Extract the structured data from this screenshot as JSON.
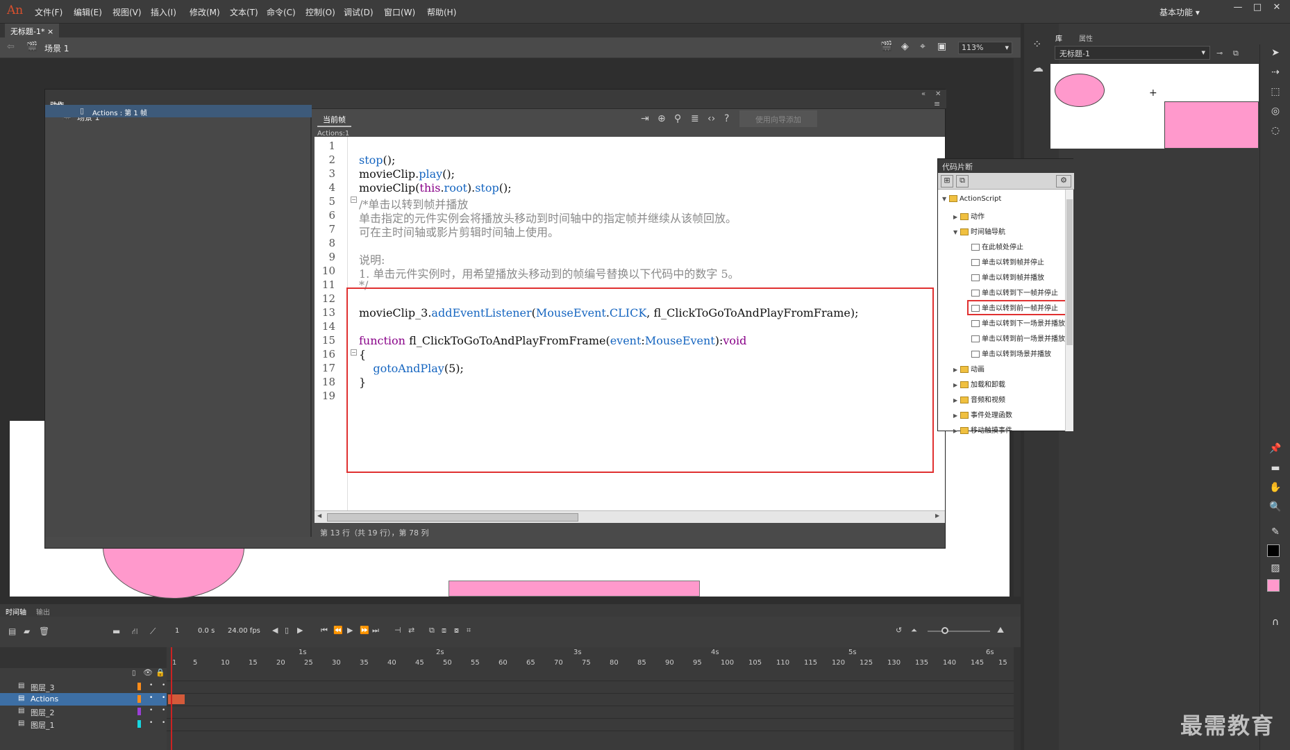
{
  "app": {
    "logo": "An"
  },
  "menu": [
    "文件(F)",
    "编辑(E)",
    "视图(V)",
    "插入(I)",
    "修改(M)",
    "文本(T)",
    "命令(C)",
    "控制(O)",
    "调试(D)",
    "窗口(W)",
    "帮助(H)"
  ],
  "workspace": "基本功能",
  "doc_tab": "无标题-1*",
  "scene": "场景 1",
  "zoom": "113%",
  "actions_panel": {
    "title": "动作",
    "tree_scene": "场景 1",
    "tree_item": "Actions : 第 1 帧",
    "tab": "当前帧",
    "subtitle": "Actions:1",
    "wizard_button": "使用向导添加",
    "status": "第 13 行（共 19 行），第 78 列"
  },
  "code_lines": [
    {
      "n": "1",
      "parts": []
    },
    {
      "n": "2",
      "parts": [
        {
          "t": "stop",
          "c": "fn"
        },
        {
          "t": "();",
          "c": ""
        }
      ]
    },
    {
      "n": "3",
      "parts": [
        {
          "t": "movieClip.",
          "c": ""
        },
        {
          "t": "play",
          "c": "fn"
        },
        {
          "t": "();",
          "c": ""
        }
      ]
    },
    {
      "n": "4",
      "parts": [
        {
          "t": "movieClip(",
          "c": ""
        },
        {
          "t": "this",
          "c": "ms"
        },
        {
          "t": ".",
          "c": ""
        },
        {
          "t": "root",
          "c": "fn"
        },
        {
          "t": ").",
          "c": ""
        },
        {
          "t": "stop",
          "c": "fn"
        },
        {
          "t": "();",
          "c": ""
        }
      ]
    },
    {
      "n": "5",
      "parts": [
        {
          "t": "/*单击以转到帧并播放",
          "c": "cm"
        }
      ]
    },
    {
      "n": "6",
      "parts": [
        {
          "t": "单击指定的元件实例会将播放头移动到时间轴中的指定帧并继续从该帧回放。",
          "c": "cm"
        }
      ]
    },
    {
      "n": "7",
      "parts": [
        {
          "t": "可在主时间轴或影片剪辑时间轴上使用。",
          "c": "cm"
        }
      ]
    },
    {
      "n": "8",
      "parts": []
    },
    {
      "n": "9",
      "parts": [
        {
          "t": "说明:",
          "c": "cm"
        }
      ]
    },
    {
      "n": "10",
      "parts": [
        {
          "t": "1. 单击元件实例时，用希望播放头移动到的帧编号替换以下代码中的数字 5。",
          "c": "cm"
        }
      ]
    },
    {
      "n": "11",
      "parts": [
        {
          "t": "*/",
          "c": "cm"
        }
      ]
    },
    {
      "n": "12",
      "parts": []
    },
    {
      "n": "13",
      "parts": [
        {
          "t": "movieClip_3.",
          "c": ""
        },
        {
          "t": "addEventListener",
          "c": "fn"
        },
        {
          "t": "(",
          "c": ""
        },
        {
          "t": "MouseEvent",
          "c": "fn"
        },
        {
          "t": ".",
          "c": ""
        },
        {
          "t": "CLICK",
          "c": "fn"
        },
        {
          "t": ", fl_ClickToGoToAndPlayFromFrame);",
          "c": ""
        }
      ]
    },
    {
      "n": "14",
      "parts": []
    },
    {
      "n": "15",
      "parts": [
        {
          "t": "function",
          "c": "ms"
        },
        {
          "t": " fl_ClickToGoToAndPlayFromFrame(",
          "c": ""
        },
        {
          "t": "event",
          "c": "fn"
        },
        {
          "t": ":",
          "c": ""
        },
        {
          "t": "MouseEvent",
          "c": "fn"
        },
        {
          "t": "):",
          "c": ""
        },
        {
          "t": "void",
          "c": "ms"
        }
      ]
    },
    {
      "n": "16",
      "parts": [
        {
          "t": "{",
          "c": ""
        }
      ]
    },
    {
      "n": "17",
      "parts": [
        {
          "t": "    ",
          "c": ""
        },
        {
          "t": "gotoAndPlay",
          "c": "fn"
        },
        {
          "t": "(5);",
          "c": ""
        }
      ]
    },
    {
      "n": "18",
      "parts": [
        {
          "t": "}",
          "c": ""
        }
      ]
    },
    {
      "n": "19",
      "parts": []
    }
  ],
  "snippets": {
    "title": "代码片断",
    "items": [
      {
        "label": "ActionScript",
        "indent": 0,
        "type": "folder",
        "arrow": "▼"
      },
      {
        "label": "动作",
        "indent": 1,
        "type": "folder",
        "arrow": "▶"
      },
      {
        "label": "时间轴导航",
        "indent": 1,
        "type": "folder",
        "arrow": "▼"
      },
      {
        "label": "在此帧处停止",
        "indent": 2,
        "type": "file",
        "arrow": ""
      },
      {
        "label": "单击以转到帧并停止",
        "indent": 2,
        "type": "file",
        "arrow": ""
      },
      {
        "label": "单击以转到帧并播放",
        "indent": 2,
        "type": "file",
        "arrow": ""
      },
      {
        "label": "单击以转到下一帧并停止",
        "indent": 2,
        "type": "file",
        "arrow": ""
      },
      {
        "label": "单击以转到前一帧并停止",
        "indent": 2,
        "type": "file",
        "arrow": ""
      },
      {
        "label": "单击以转到下一场景并播放",
        "indent": 2,
        "type": "file",
        "arrow": ""
      },
      {
        "label": "单击以转到前一场景并播放",
        "indent": 2,
        "type": "file",
        "arrow": ""
      },
      {
        "label": "单击以转到场景并播放",
        "indent": 2,
        "type": "file",
        "arrow": ""
      },
      {
        "label": "动画",
        "indent": 1,
        "type": "folder",
        "arrow": "▶"
      },
      {
        "label": "加载和卸载",
        "indent": 1,
        "type": "folder",
        "arrow": "▶"
      },
      {
        "label": "音频和视频",
        "indent": 1,
        "type": "folder",
        "arrow": "▶"
      },
      {
        "label": "事件处理函数",
        "indent": 1,
        "type": "folder",
        "arrow": "▶"
      },
      {
        "label": "移动触摸事件",
        "indent": 1,
        "type": "folder",
        "arrow": "▶"
      }
    ]
  },
  "library": {
    "tab_library": "库",
    "tab_properties": "属性",
    "doc": "无标题-1"
  },
  "timeline": {
    "tab_timeline": "时间轴",
    "tab_output": "输出",
    "frame": "1",
    "time": "0.0 s",
    "fps": "24.00 fps",
    "seconds": [
      "1s",
      "2s",
      "3s",
      "4s",
      "5s",
      "6s"
    ],
    "ticks": [
      "1",
      "5",
      "10",
      "15",
      "20",
      "25",
      "30",
      "35",
      "40",
      "45",
      "50",
      "55",
      "60",
      "65",
      "70",
      "75",
      "80",
      "85",
      "90",
      "95",
      "100",
      "105",
      "110",
      "115",
      "120",
      "125",
      "130",
      "135",
      "140",
      "145",
      "15"
    ],
    "layers": [
      {
        "name": "图层_3",
        "color": "#ff8c1a"
      },
      {
        "name": "Actions",
        "color": "#ff8c1a"
      },
      {
        "name": "图层_2",
        "color": "#9b3fd6"
      },
      {
        "name": "图层_1",
        "color": "#17d6e0"
      }
    ]
  },
  "watermark": "最需教育",
  "colors": {
    "pink": "#ff99cc",
    "red_box": "#e03030"
  }
}
